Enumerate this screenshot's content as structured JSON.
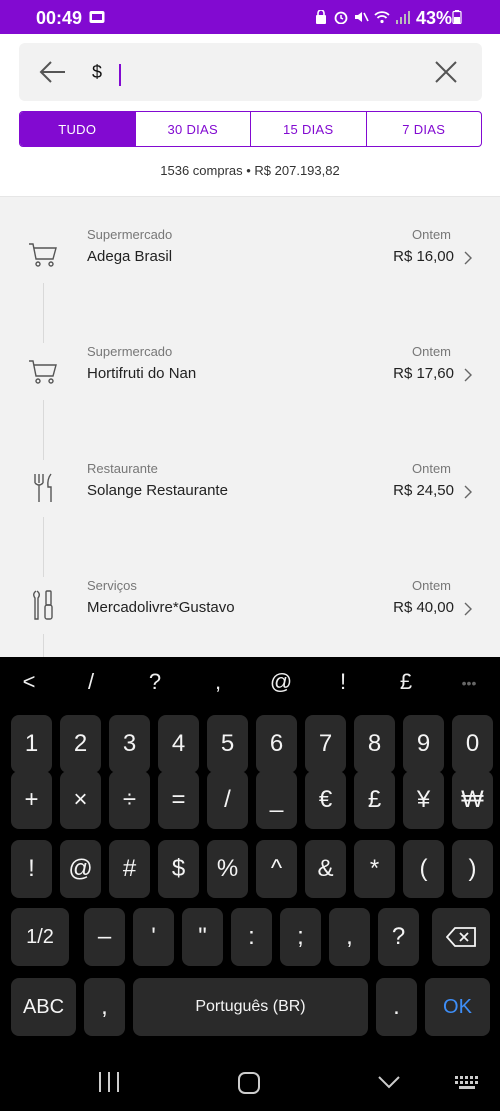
{
  "status_bar": {
    "time": "00:49",
    "battery_percent": "43%"
  },
  "search": {
    "value": "$",
    "placeholder": ""
  },
  "filters": {
    "tabs": [
      "TUDO",
      "30 DIAS",
      "15 DIAS",
      "7 DIAS"
    ],
    "active": "TUDO"
  },
  "summary": "1536 compras • R$ 207.193,82",
  "transactions": [
    {
      "category": "Supermercado",
      "name": "Adega Brasil",
      "date": "Ontem",
      "amount": "R$ 16,00",
      "icon": "cart-icon"
    },
    {
      "category": "Supermercado",
      "name": "Hortifruti do Nan",
      "date": "Ontem",
      "amount": "R$ 17,60",
      "icon": "cart-icon"
    },
    {
      "category": "Restaurante",
      "name": "Solange Restaurante",
      "date": "Ontem",
      "amount": "R$ 24,50",
      "icon": "cutlery-icon"
    },
    {
      "category": "Serviços",
      "name": "Mercadolivre*Gustavo",
      "date": "Ontem",
      "amount": "R$ 40,00",
      "icon": "tools-icon"
    }
  ],
  "keyboard": {
    "toolbar": [
      "<",
      "/",
      "?",
      ",",
      "@",
      "!",
      "£",
      "•••"
    ],
    "row1": [
      "1",
      "2",
      "3",
      "4",
      "5",
      "6",
      "7",
      "8",
      "9",
      "0"
    ],
    "row2": [
      "+",
      "×",
      "÷",
      "=",
      "/",
      "_",
      "€",
      "£",
      "¥",
      "₩"
    ],
    "row3": [
      "!",
      "@",
      "#",
      "$",
      "%",
      "^",
      "&",
      "*",
      "(",
      ")"
    ],
    "row4": [
      "1/2",
      "–",
      "'",
      "\"",
      ":",
      ";",
      ",",
      "?"
    ],
    "row5": {
      "abc": "ABC",
      "comma": ",",
      "space": "Português (BR)",
      "period": ".",
      "ok": "OK"
    }
  },
  "colors": {
    "accent": "#820ad1",
    "ok_key": "#3e8ef7"
  }
}
